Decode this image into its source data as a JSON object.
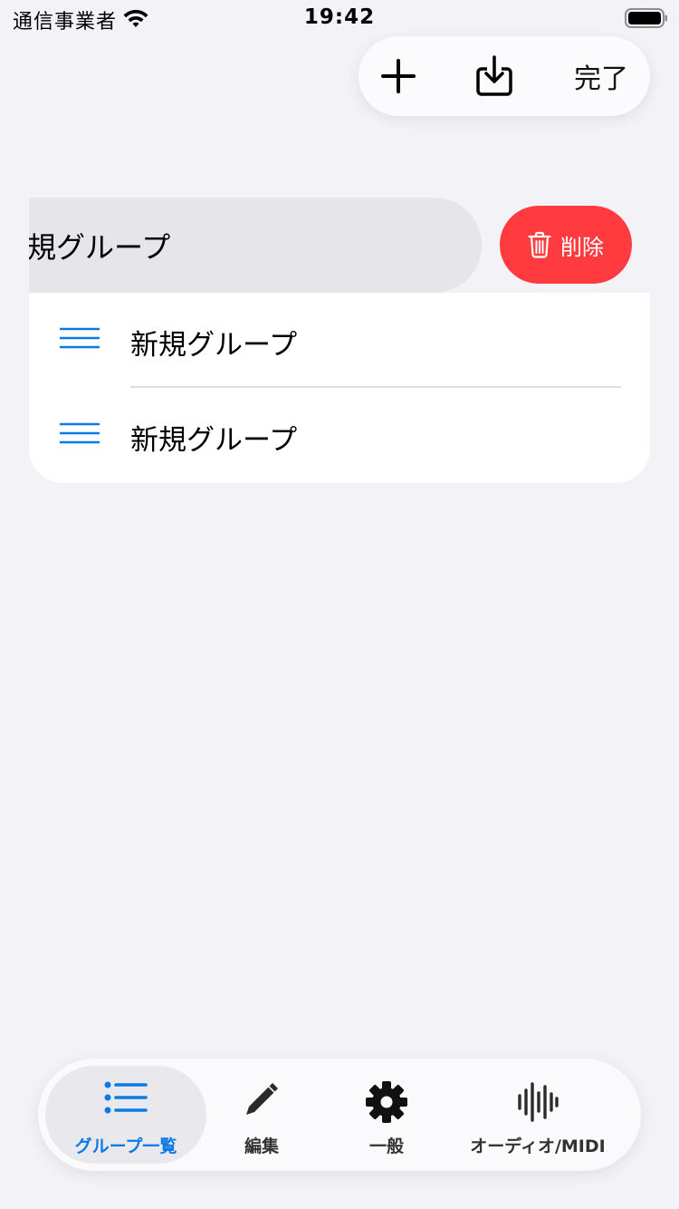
{
  "status_bar": {
    "carrier": "通信事業者",
    "time": "19:42"
  },
  "toolbar": {
    "add_icon": "plus-icon",
    "import_icon": "tray-arrow-down-icon",
    "done_label": "完了"
  },
  "swiped_row": {
    "label": "新規グループ",
    "delete_label": "削除",
    "delete_color": "#ff3b3f"
  },
  "list": {
    "items": [
      {
        "label": "新規グループ"
      },
      {
        "label": "新規グループ"
      }
    ]
  },
  "tab_bar": {
    "accent_color": "#0a7ae6",
    "tabs": [
      {
        "label": "グループ一覧",
        "icon": "list-bullet-icon",
        "selected": true
      },
      {
        "label": "編集",
        "icon": "pencil-icon",
        "selected": false
      },
      {
        "label": "一般",
        "icon": "gear-icon",
        "selected": false
      },
      {
        "label": "オーディオ/MIDI",
        "icon": "waveform-icon",
        "selected": false
      }
    ]
  }
}
